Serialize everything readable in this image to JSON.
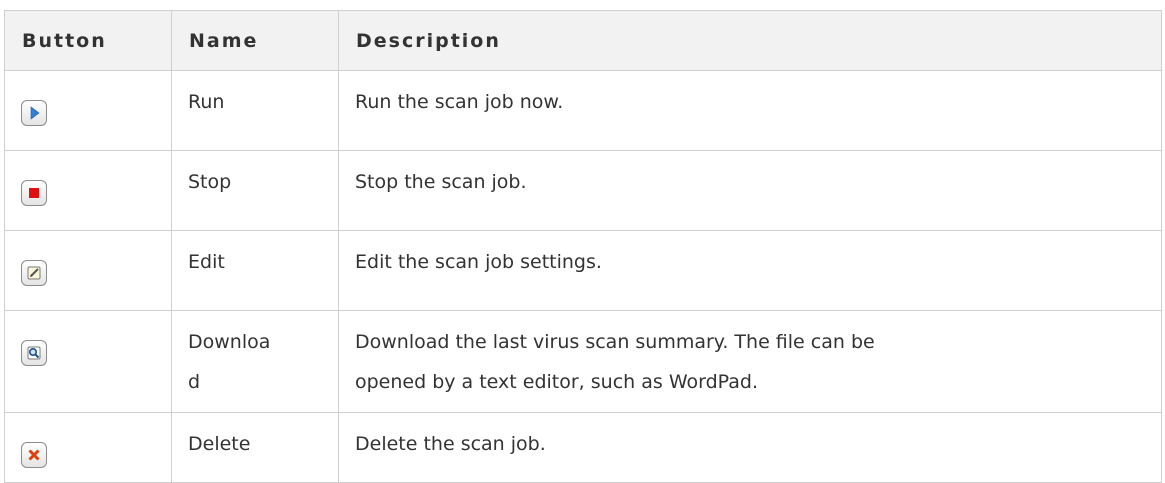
{
  "table": {
    "headers": {
      "button": "Button",
      "name": "Name",
      "description": "Description"
    },
    "rows": [
      {
        "icon": "play-icon",
        "name": "Run",
        "description": "Run the scan job now."
      },
      {
        "icon": "stop-icon",
        "name": "Stop",
        "description": "Stop the scan job."
      },
      {
        "icon": "edit-icon",
        "name": "Edit",
        "description": "Edit the scan job settings."
      },
      {
        "icon": "download-magnifier-icon",
        "name_line1": "Downloa",
        "name_line2": "d",
        "description_line1": "Download the last virus scan summary. The file can be",
        "description_line2": "opened by a text editor, such as WordPad."
      },
      {
        "icon": "delete-icon",
        "name": "Delete",
        "description": "Delete the scan job."
      }
    ]
  },
  "colors": {
    "header_bg": "#f2f2f2",
    "border": "#cfcfcf",
    "text": "#333333",
    "play": "#2f7fd6",
    "stop": "#e01010",
    "delete": "#e04010"
  }
}
